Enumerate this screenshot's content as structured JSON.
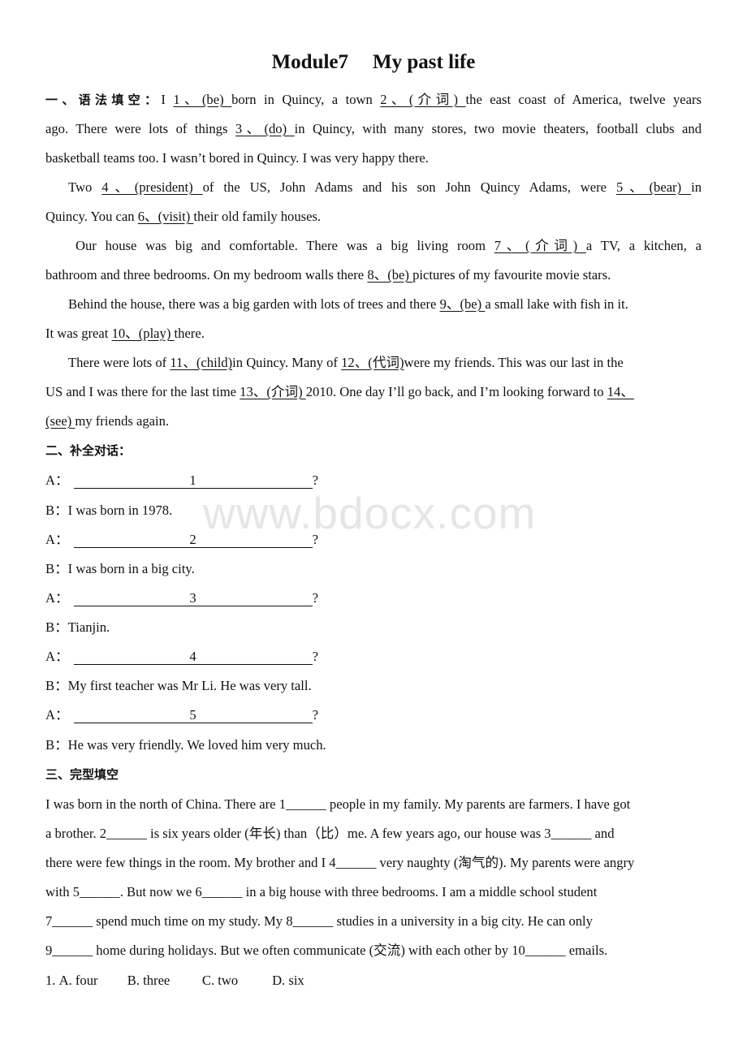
{
  "title": {
    "part1": "Module7",
    "part2": "My past life"
  },
  "section1": {
    "heading": "一、语法填空：",
    "lines": [
      {
        "t0": "I ",
        "b1": " 1、(be) ",
        "t1": "born in Quincy, a town ",
        "b2": "2、(介词) ",
        "t2": " the east coast of America, twelve years"
      },
      {
        "t0": "ago. There were lots of things ",
        "b1": "3、(do) ",
        "t1": "in Quincy, with many stores, two movie theaters, football clubs and"
      },
      {
        "t0": "basketball teams too. I wasn’t bored in Quincy. I was very happy there."
      },
      {
        "t0": "Two ",
        "b1": "4、(president) ",
        "t1": " of the US, John Adams and his son John Quincy Adams, were ",
        "b2": "5、(bear) ",
        "t2": "in"
      },
      {
        "t0": "Quincy. You can ",
        "b1": "6、(visit) ",
        "t1": "their old family houses."
      },
      {
        "t0": "Our house was big and comfortable. There was a big living room ",
        "b1": "7、(介词) ",
        "t1": "a TV, a kitchen, a"
      },
      {
        "t0": "bathroom and three bedrooms. On my bedroom walls there ",
        "b1": "8、(be) ",
        "t1": "pictures of my favourite movie stars."
      },
      {
        "t0": "Behind the house, there was a big garden with lots of trees and there ",
        "b1": "9、(be) ",
        "t1": "a small lake with fish in it."
      },
      {
        "t0": "It was great ",
        "b1": "10、(play) ",
        "t1": " there."
      },
      {
        "t0": "There were lots of ",
        "b1": "11、(child)",
        "t1": "in Quincy. Many of ",
        "b2": "12、(代词)",
        "t2": "were my friends. This was our last in the"
      },
      {
        "t0": "US and I was there for the last time ",
        "b1": "13、(介词) ",
        "t1": "2010. One day I’ll go back, and I’m looking forward to ",
        "b2": "14、"
      },
      {
        "b1": " (see) ",
        "t1": "my friends again."
      }
    ]
  },
  "section2": {
    "heading": "二、补全对话：",
    "dialog": [
      {
        "speaker": "A：",
        "blank": "1",
        "end": "?"
      },
      {
        "speaker": "B：",
        "text": "I was born in 1978."
      },
      {
        "speaker": "A：",
        "blank": "2",
        "end": "?"
      },
      {
        "speaker": "B：",
        "text": "I was born in a big city."
      },
      {
        "speaker": "A：",
        "blank": "3",
        "end": "?"
      },
      {
        "speaker": "B：",
        "text": "Tianjin."
      },
      {
        "speaker": "A：",
        "blank": "4",
        "end": "?"
      },
      {
        "speaker": "B：",
        "text": "My first teacher was Mr Li.  He was very tall."
      },
      {
        "speaker": "A：",
        "blank": "5",
        "end": "?"
      },
      {
        "speaker": "B：",
        "text": "He was very friendly.  We loved him very much."
      }
    ]
  },
  "section3": {
    "heading": "三、完型填空",
    "lines": [
      "I was born in the north of China. There are 1______ people in my family. My parents are farmers. I have got",
      "a brother. 2______ is six years older (年长) than（比）me. A few years ago, our house was 3______ and",
      "there were few things in the room. My brother and I 4______ very naughty (淘气的). My parents were angry",
      "with   5______. But now we 6______ in a big house with three bedrooms. I am a middle school student",
      "7______   spend much time on my study. My 8______ studies in a university in a big city. He can only",
      "9______   home during holidays. But we often communicate (交流) with each other by 10______ emails."
    ],
    "question1": {
      "number": "1.",
      "options": [
        "A. four",
        "B. three",
        "C. two",
        "D. six"
      ]
    }
  },
  "watermark": "www.bdocx.com"
}
